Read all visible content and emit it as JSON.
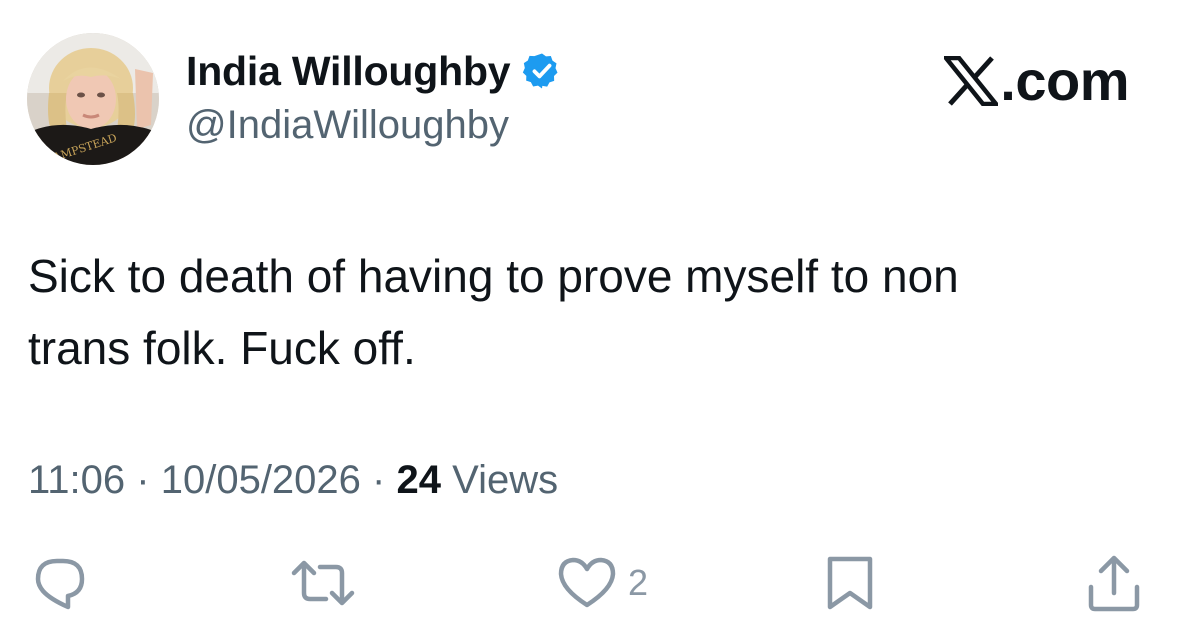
{
  "author": {
    "display_name": "India Willoughby",
    "handle": "@IndiaWilloughby",
    "verified_badge_color": "#1d9bf0",
    "avatar_shirt_text": "HAMPSTEAD"
  },
  "brand": {
    "text": ".com",
    "icon": "x-logo-icon"
  },
  "tweet": {
    "text": "Sick to death of having to prove myself to non\ntrans folk. Fuck off.",
    "time": "11:06",
    "separator": "·",
    "date": "10/05/2026",
    "views_count": "24",
    "views_label": "Views"
  },
  "actions": {
    "reply_icon": "reply-icon",
    "retweet_icon": "retweet-icon",
    "like_icon": "heart-icon",
    "like_count": "2",
    "bookmark_icon": "bookmark-icon",
    "share_icon": "share-icon"
  },
  "colors": {
    "text_primary": "#0f1419",
    "text_secondary": "#536471",
    "action_icon": "#8b98a5"
  }
}
